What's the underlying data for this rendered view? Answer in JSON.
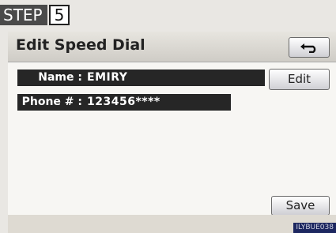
{
  "step": {
    "label": "STEP",
    "number": "5"
  },
  "header": {
    "title": "Edit Speed Dial",
    "back_icon": "back-arrow-icon"
  },
  "fields": [
    {
      "label": "Name :",
      "value": "EMIRY"
    },
    {
      "label": "Phone # :",
      "value": "123456****"
    }
  ],
  "buttons": {
    "edit_label": "Edit",
    "save_label": "Save"
  },
  "figure_code": "ILYBUE038"
}
